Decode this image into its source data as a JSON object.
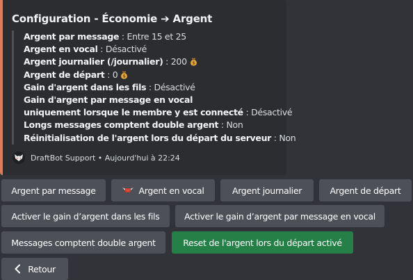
{
  "embed": {
    "title": "Configuration - Économie ➔ Argent",
    "accent_color": "#e07b53",
    "fields": [
      {
        "label": "Argent par message",
        "sep": " : ",
        "value": "Entre 15 et 25"
      },
      {
        "label": "Argent en vocal",
        "sep": " : ",
        "value": "Désactivé"
      },
      {
        "label": "Argent journalier (/journalier)",
        "sep": " : ",
        "value": "200",
        "icon": "money-bag-icon"
      },
      {
        "label": "Argent de départ",
        "sep": " : ",
        "value": "0",
        "icon": "money-bag-icon"
      },
      {
        "label": "Gain d'argent dans les fils",
        "sep": " : ",
        "value": "Désactivé"
      },
      {
        "label": "Gain d'argent par message en vocal",
        "sep": "",
        "value": ""
      },
      {
        "label": "uniquement lorsque le membre y est connecté",
        "sep": " : ",
        "value": "Désactivé"
      },
      {
        "label": "Longs messages comptent double argent",
        "sep": " : ",
        "value": "Non"
      },
      {
        "label": "Réinitialisation de l'argent lors du départ du serveur",
        "sep": " : ",
        "value": "Non"
      }
    ],
    "footer": {
      "author": "DraftBot Support",
      "separator": " • ",
      "timestamp": "Aujourd'hui à 22:24",
      "avatar_icon": "draftbot-avatar-icon"
    }
  },
  "buttons": {
    "argent_par_message": "Argent par message",
    "argent_en_vocal": "Argent en vocal",
    "argent_journalier": "Argent journalier",
    "argent_de_depart": "Argent de départ",
    "gain_fils": "Activer le gain d’argent dans les fils",
    "gain_vocal": "Activer le gain d’argent par message en vocal",
    "messages_double": "Messages comptent double argent",
    "reset_depart": "Reset de l'argent lors du départ activé",
    "retour": "Retour"
  },
  "colors": {
    "background": "#313338",
    "embed_background": "#2b2d31",
    "button_secondary": "#4e5058",
    "button_success": "#248046"
  }
}
